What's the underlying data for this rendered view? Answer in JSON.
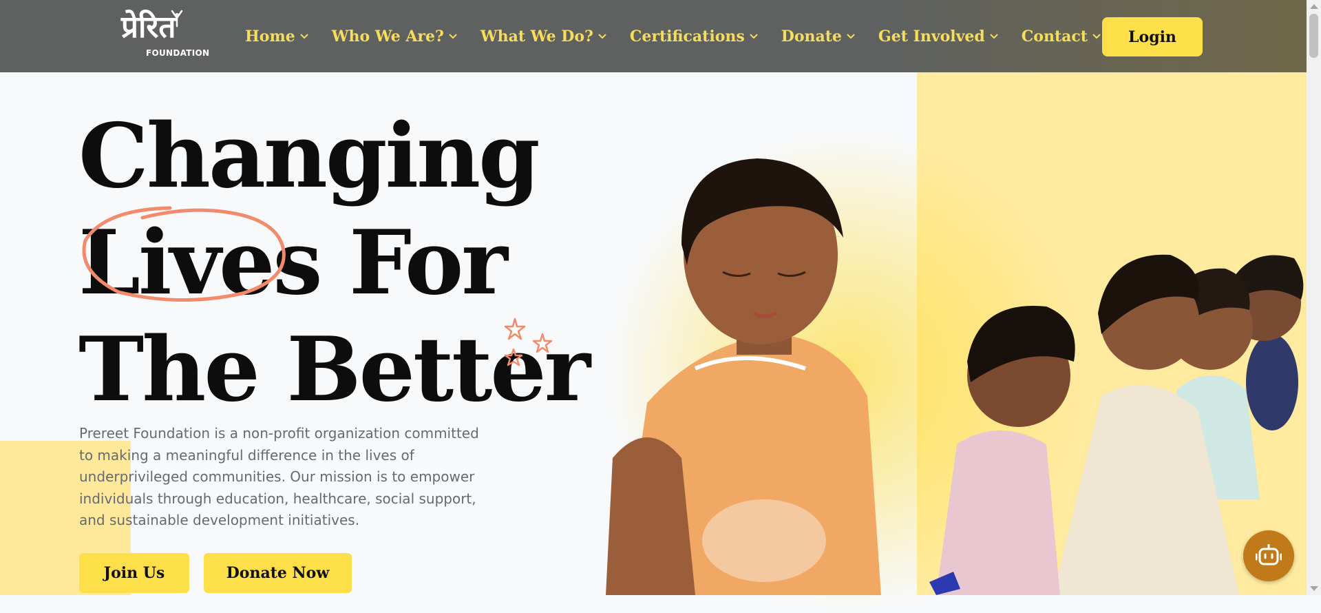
{
  "brand": {
    "logo_text": "प्रेरित",
    "logo_sub": "FOUNDATION"
  },
  "nav": {
    "items": [
      {
        "label": "Home",
        "icon": "chevron-down-icon"
      },
      {
        "label": "Who We Are?",
        "icon": "chevron-down-icon"
      },
      {
        "label": "What We Do?",
        "icon": "chevron-down-icon"
      },
      {
        "label": "Certifications",
        "icon": "chevron-down-icon"
      },
      {
        "label": "Donate",
        "icon": "chevron-down-icon"
      },
      {
        "label": "Get Involved",
        "icon": "chevron-down-icon"
      },
      {
        "label": "Contact",
        "icon": "chevron-down-icon"
      }
    ],
    "login_label": "Login"
  },
  "hero": {
    "line1": "Changing",
    "line2_highlight": "Lives",
    "line2_rest": " For",
    "line3": "The Better",
    "description": "Prereet Foundation is a non-profit organization committed to making a meaningful difference in the lives of underprivileged communities. Our mission is to empower individuals through education, healthcare, social support, and sustainable development initiatives.",
    "join_label": "Join Us",
    "donate_label": "Donate Now"
  },
  "chat": {
    "icon": "robot-icon"
  },
  "colors": {
    "nav_bg": "#5f6160",
    "nav_text": "#f6dd5a",
    "accent_yellow": "#fddf4a",
    "highlight_circle": "#f28b6c",
    "chat_button": "#c07a1a",
    "body_text": "#666a70"
  }
}
